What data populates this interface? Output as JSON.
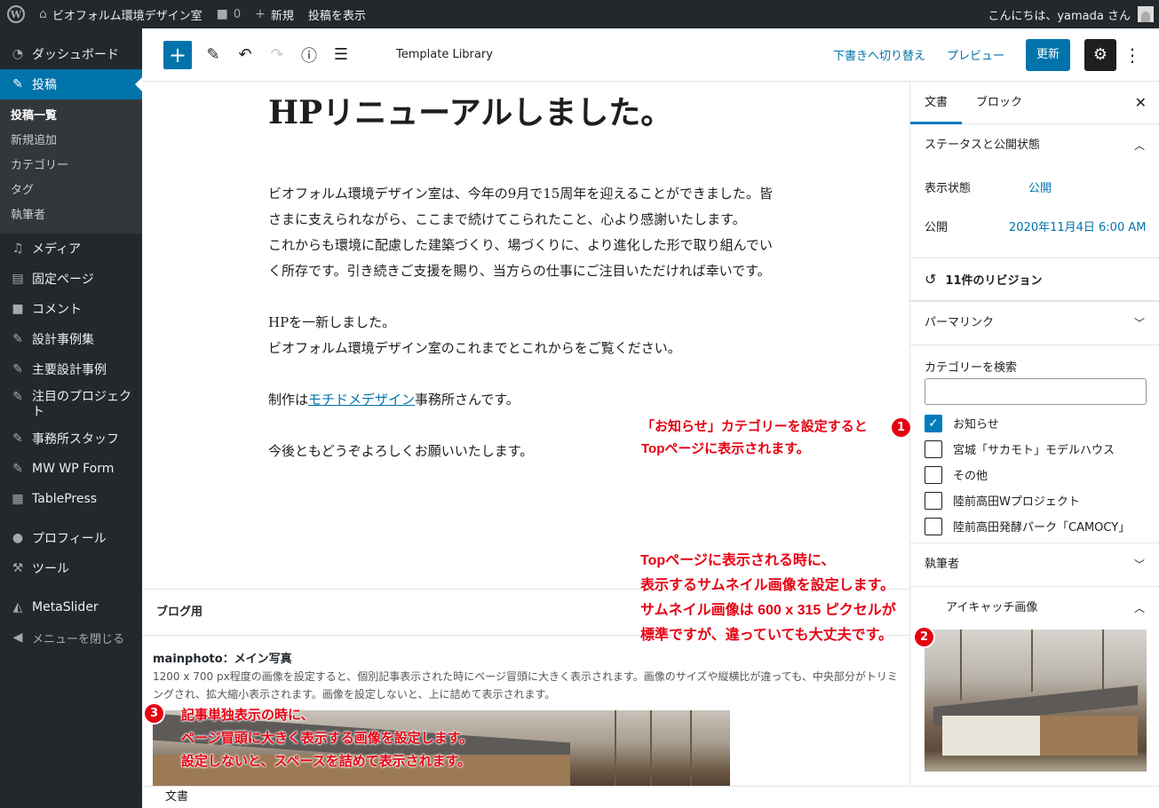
{
  "adminbar": {
    "site_name": "ビオフォルム環境デザイン室",
    "comments_count": "0",
    "new_label": "新規",
    "view_post_label": "投稿を表示",
    "greeting": "こんにちは、yamada さん"
  },
  "sidebar": {
    "items": [
      {
        "label": "ダッシュボード",
        "icon": "dashboard-icon"
      },
      {
        "label": "投稿",
        "icon": "pin-icon"
      },
      {
        "label": "メディア",
        "icon": "media-icon"
      },
      {
        "label": "固定ページ",
        "icon": "page-icon"
      },
      {
        "label": "コメント",
        "icon": "comment-icon"
      },
      {
        "label": "設計事例集",
        "icon": "pin-icon"
      },
      {
        "label": "主要設計事例",
        "icon": "pin-icon"
      },
      {
        "label": "注目のプロジェクト",
        "icon": "pin-icon"
      },
      {
        "label": "事務所スタッフ",
        "icon": "pin-icon"
      },
      {
        "label": "MW WP Form",
        "icon": "pin-icon"
      },
      {
        "label": "TablePress",
        "icon": "table-icon"
      },
      {
        "label": "プロフィール",
        "icon": "user-icon"
      },
      {
        "label": "ツール",
        "icon": "wrench-icon"
      },
      {
        "label": "MetaSlider",
        "icon": "metaslider-icon"
      },
      {
        "label": "メニューを閉じる",
        "icon": "collapse-icon"
      }
    ],
    "submenu": [
      "投稿一覧",
      "新規追加",
      "カテゴリー",
      "タグ",
      "執筆者"
    ]
  },
  "toolbar": {
    "template_library": "Template Library",
    "switch_draft": "下書きへ切り替え",
    "preview": "プレビュー",
    "update": "更新"
  },
  "post": {
    "title": "HPリニューアルしました。",
    "paragraphs": [
      "ビオフォルム環境デザイン室は、今年の9月で15周年を迎えることができました。皆さまに支えられながら、ここまで続けてこられたこと、心より感謝いたします。",
      "これからも環境に配慮した建築づくり、場づくりに、より進化した形で取り組んでいく所存です。引き続きご支援を賜り、当方らの仕事にご注目いただければ幸いです。"
    ],
    "p2_line1": "HPを一新しました。",
    "p2_line2": "ビオフォルム環境デザイン室のこれまでとこれからをご覧ください。",
    "p3_prefix": "制作は",
    "p3_link": "モチドメデザイン",
    "p3_suffix": "事務所さんです。",
    "p4": "今後ともどうぞよろしくお願いいたします。"
  },
  "metabox": {
    "title": "ブログ用",
    "field_label": "mainphoto：メイン写真",
    "field_desc": "1200 x 700 px程度の画像を設定すると、個別記事表示された時にページ冒頭に大きく表示されます。画像のサイズや縦横比が違っても、中央部分がトリミングされ、拡大縮小表示されます。画像を設定しないと、上に詰めて表示されます。"
  },
  "settings": {
    "tab_document": "文書",
    "tab_block": "ブロック",
    "status_panel": "ステータスと公開状態",
    "visibility_label": "表示状態",
    "visibility_value": "公開",
    "publish_label": "公開",
    "publish_value": "2020年11月4日 6:00 AM",
    "revisions": "11件のリビジョン",
    "permalink": "パーマリンク",
    "category_search_label": "カテゴリーを検索",
    "categories": [
      {
        "label": "お知らせ",
        "checked": true
      },
      {
        "label": "宮城「サカモト」モデルハウス",
        "checked": false
      },
      {
        "label": "その他",
        "checked": false
      },
      {
        "label": "陸前高田Wプロジェクト",
        "checked": false
      },
      {
        "label": "陸前高田発酵パーク「CAMOCY」",
        "checked": false
      }
    ],
    "author_panel": "執筆者",
    "featured_panel": "アイキャッチ画像"
  },
  "footer": {
    "breadcrumb": "文書"
  },
  "annotations": {
    "a1_line1": "「お知らせ」カテゴリーを設定すると",
    "a1_line2": "Topページに表示されます。",
    "a2_line1": "Topページに表示される時に、",
    "a2_line2": "表示するサムネイル画像を設定します。",
    "a2_line3": "サムネイル画像は 600 x 315 ピクセルが",
    "a2_line4": "標準ですが、違っていても大丈夫です。",
    "a3_line1": "記事単独表示の時に、",
    "a3_line2": "ページ冒頭に大きく表示する画像を設定します。",
    "a3_line3": "設定しないと、スペースを詰めて表示されます。",
    "badge1": "1",
    "badge2": "2",
    "badge3": "3"
  },
  "colors": {
    "admin_dark": "#23282d",
    "accent_blue": "#0073aa",
    "annotation_red": "#e60012"
  }
}
